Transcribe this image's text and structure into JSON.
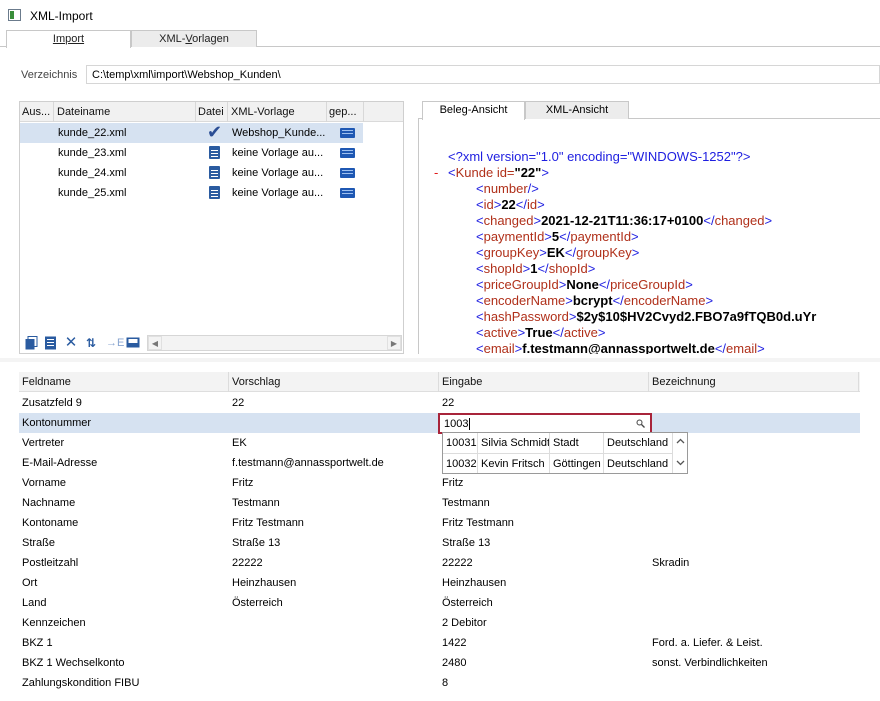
{
  "window": {
    "title": "XML-Import"
  },
  "main_tabs": [
    {
      "label": "Import",
      "active": true
    },
    {
      "label_pre": "XML-",
      "label_u": "V",
      "label_post": "orlagen",
      "active": false
    }
  ],
  "directory": {
    "label": "Verzeichnis",
    "value": "C:\\temp\\xml\\import\\Webshop_Kunden\\"
  },
  "file_list": {
    "columns": [
      "Aus...",
      "Dateiname",
      "Datei",
      "XML-Vorlage",
      "gep..."
    ],
    "rows": [
      {
        "name": "kunde_22.xml",
        "status_icon": "check-icon",
        "vorlage": "Webshop_Kunde...",
        "selected": true
      },
      {
        "name": "kunde_23.xml",
        "status_icon": "document-icon",
        "vorlage": "keine Vorlage au...",
        "selected": false
      },
      {
        "name": "kunde_24.xml",
        "status_icon": "document-icon",
        "vorlage": "keine Vorlage au...",
        "selected": false
      },
      {
        "name": "kunde_25.xml",
        "status_icon": "document-icon",
        "vorlage": "keine Vorlage au...",
        "selected": false
      }
    ]
  },
  "view_tabs": [
    {
      "label": "Beleg-Ansicht",
      "active": true
    },
    {
      "label": "XML-Ansicht",
      "active": false
    }
  ],
  "xml": {
    "declaration": "<?xml version=\"1.0\" encoding=\"WINDOWS-1252\"?>",
    "root_open": "Kunde",
    "root_attr_name": "id=",
    "root_attr_value": "\"22\"",
    "number_tag": "number",
    "elements": [
      {
        "tag": "id",
        "value": "22"
      },
      {
        "tag": "changed",
        "value": "2021-12-21T11:36:17+0100"
      },
      {
        "tag": "paymentId",
        "value": "5"
      },
      {
        "tag": "groupKey",
        "value": "EK"
      },
      {
        "tag": "shopId",
        "value": "1"
      },
      {
        "tag": "priceGroupId",
        "value": "None"
      },
      {
        "tag": "encoderName",
        "value": "bcrypt"
      },
      {
        "tag": "hashPassword",
        "value": "$2y$10$HV2Cvyd2.FBO7a9fTQB0d.uYr"
      },
      {
        "tag": "active",
        "value": "True"
      },
      {
        "tag": "email",
        "value": "f.testmann@annassportwelt.de"
      }
    ]
  },
  "field_grid": {
    "columns": [
      "Feldname",
      "Vorschlag",
      "Eingabe",
      "Bezeichnung"
    ],
    "rows": [
      {
        "feld": "Zusatzfeld 9",
        "vorschlag": "22",
        "eingabe": "22",
        "bez": ""
      },
      {
        "feld": "Kontonummer",
        "vorschlag": "",
        "eingabe": "",
        "bez": "",
        "highlight": true
      },
      {
        "feld": "Vertreter",
        "vorschlag": "EK",
        "eingabe": "",
        "bez": ""
      },
      {
        "feld": "E-Mail-Adresse",
        "vorschlag": "f.testmann@annassportwelt.de",
        "eingabe": "",
        "bez": ""
      },
      {
        "feld": "Vorname",
        "vorschlag": "Fritz",
        "eingabe": "Fritz",
        "bez": ""
      },
      {
        "feld": "Nachname",
        "vorschlag": "Testmann",
        "eingabe": "Testmann",
        "bez": ""
      },
      {
        "feld": "Kontoname",
        "vorschlag": "Fritz Testmann",
        "eingabe": "Fritz Testmann",
        "bez": ""
      },
      {
        "feld": "Straße",
        "vorschlag": "Straße 13",
        "eingabe": "Straße 13",
        "bez": ""
      },
      {
        "feld": "Postleitzahl",
        "vorschlag": "22222",
        "eingabe": "22222",
        "bez": "Skradin"
      },
      {
        "feld": "Ort",
        "vorschlag": "Heinzhausen",
        "eingabe": "Heinzhausen",
        "bez": ""
      },
      {
        "feld": "Land",
        "vorschlag": "Österreich",
        "eingabe": "Österreich",
        "bez": ""
      },
      {
        "feld": "Kennzeichen",
        "vorschlag": "",
        "eingabe": "2  Debitor",
        "bez": ""
      },
      {
        "feld": "BKZ 1",
        "vorschlag": "",
        "eingabe": "1422",
        "bez": "Ford. a. Liefer. & Leist."
      },
      {
        "feld": "BKZ 1 Wechselkonto",
        "vorschlag": "",
        "eingabe": "2480",
        "bez": "sonst. Verbindlichkeiten"
      },
      {
        "feld": "Zahlungskondition FIBU",
        "vorschlag": "",
        "eingabe": "8",
        "bez": ""
      }
    ]
  },
  "kontonummer_input": {
    "value": "1003"
  },
  "kontonummer_suggestions": [
    {
      "nr": "10031",
      "name": "Silvia Schmidt",
      "ort": "Stadt",
      "land": "Deutschland"
    },
    {
      "nr": "10032",
      "name": "Kevin Fritsch",
      "ort": "Göttingen",
      "land": "Deutschland"
    }
  ]
}
